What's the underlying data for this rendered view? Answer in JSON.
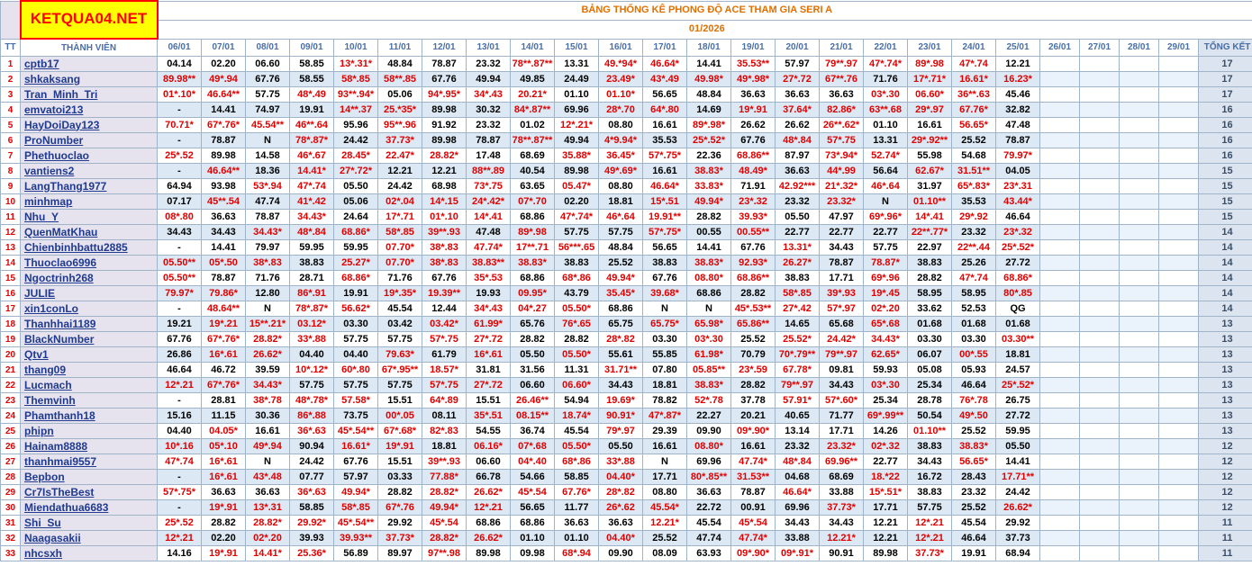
{
  "logo": "KETQUA04.NET",
  "title": "BẢNG THỐNG KÊ PHONG ĐỘ ACE THAM GIA SERI A",
  "month": "01/2026",
  "headers": {
    "tt": "TT",
    "member": "THÀNH VIÊN",
    "dates": [
      "06/01",
      "07/01",
      "08/01",
      "09/01",
      "10/01",
      "11/01",
      "12/01",
      "13/01",
      "14/01",
      "15/01",
      "16/01",
      "17/01",
      "18/01",
      "19/01",
      "20/01",
      "21/01",
      "22/01",
      "23/01",
      "24/01",
      "25/01",
      "26/01",
      "27/01",
      "28/01",
      "29/01"
    ],
    "total": "TỔNG KẾT"
  },
  "rows": [
    {
      "tt": "1",
      "name": "cptb17",
      "vals": [
        "04.14",
        "02.20",
        "06.60",
        "58.85",
        "13*.31*",
        "48.84",
        "78.87",
        "23.32",
        "78**.87**",
        "13.31",
        "49.*94*",
        "46.64*",
        "14.41",
        "35.53**",
        "57.97",
        "79**.97",
        "47*.74*",
        "89*.98",
        "47*.74",
        "12.21"
      ],
      "total": "17"
    },
    {
      "tt": "2",
      "name": "shkaksang",
      "vals": [
        "89.98**",
        "49*.94",
        "67.76",
        "58.55",
        "58*.85",
        "58**.85",
        "67.76",
        "49.94",
        "49.85",
        "24.49",
        "23.49*",
        "43*.49",
        "49.98*",
        "49*.98*",
        "27*.72",
        "67**.76",
        "71.76",
        "17*.71*",
        "16.61*",
        "16.23*"
      ],
      "total": "17"
    },
    {
      "tt": "3",
      "name": "Tran_Minh_Tri",
      "vals": [
        "01*.10*",
        "46.64**",
        "57.75",
        "48*.49",
        "93**.94*",
        "05.06",
        "94*.95*",
        "34*.43",
        "20.21*",
        "01.10",
        "01.10*",
        "56.65",
        "48.84",
        "36.63",
        "36.63",
        "36.63",
        "03*.30",
        "06.60*",
        "36**.63",
        "45.46"
      ],
      "total": "17"
    },
    {
      "tt": "4",
      "name": "emvatoi213",
      "vals": [
        "-",
        "14.41",
        "74.97",
        "19.91",
        "14**.37",
        "25.*35*",
        "89.98",
        "30.32",
        "84*.87**",
        "69.96",
        "28*.70",
        "64*.80",
        "14.69",
        "19*.91",
        "37.64*",
        "82.86*",
        "63**.68",
        "29*.97",
        "67.76*",
        "32.82"
      ],
      "total": "16"
    },
    {
      "tt": "5",
      "name": "HayDoiDay123",
      "vals": [
        "70.71*",
        "67*.76*",
        "45.54**",
        "46**.64",
        "95.96",
        "95**.96",
        "91.92",
        "23.32",
        "01.02",
        "12*.21*",
        "08.80",
        "16.61",
        "89*.98*",
        "26.62",
        "26.62",
        "26**.62*",
        "01.10",
        "16.61",
        "56.65*",
        "47.48"
      ],
      "total": "16"
    },
    {
      "tt": "6",
      "name": "ProNumber",
      "vals": [
        "-",
        "78.87",
        "N",
        "78*.87*",
        "24.42",
        "37.73*",
        "89.98",
        "78.87",
        "78**.87**",
        "49.94",
        "4*9.94*",
        "35.53",
        "25*.52*",
        "67.76",
        "48*.84",
        "57*.75",
        "13.31",
        "29*.92**",
        "25.52",
        "78.87"
      ],
      "total": "16"
    },
    {
      "tt": "7",
      "name": "Phethuoclao",
      "vals": [
        "25*.52",
        "89.98",
        "14.58",
        "46*.67",
        "28.45*",
        "22.47*",
        "28.82*",
        "17.48",
        "68.69",
        "35.88*",
        "36.45*",
        "57*.75*",
        "22.36",
        "68.86**",
        "87.97",
        "73*.94*",
        "52.74*",
        "55.98",
        "54.68",
        "79.97*"
      ],
      "total": "16"
    },
    {
      "tt": "8",
      "name": "vantiens2",
      "vals": [
        "-",
        "46.64**",
        "18.36",
        "14.41*",
        "27*.72*",
        "12.21",
        "12.21",
        "88**.89",
        "40.54",
        "89.98",
        "49*.69*",
        "16.61",
        "38.83*",
        "48.49*",
        "36.63",
        "44*.99",
        "56.64",
        "62.67*",
        "31.51**",
        "04.05"
      ],
      "total": "15"
    },
    {
      "tt": "9",
      "name": "LangThang1977",
      "vals": [
        "64.94",
        "93.98",
        "53*.94",
        "47*.74",
        "05.50",
        "24.42",
        "68.98",
        "73*.75",
        "63.65",
        "05.47*",
        "08.80",
        "46.64*",
        "33.83*",
        "71.91",
        "42.92***",
        "21*.32*",
        "46*.64",
        "31.97",
        "65*.83*",
        "23*.31"
      ],
      "total": "15"
    },
    {
      "tt": "10",
      "name": "minhmap",
      "vals": [
        "07.17",
        "45**.54",
        "47.74",
        "41*.42",
        "05.06",
        "02*.04",
        "14*.15",
        "24*.42*",
        "07*.70",
        "02.20",
        "18.81",
        "15*.51",
        "49.94*",
        "23*.32",
        "23.32",
        "23.32*",
        "N",
        "01.10**",
        "35.53",
        "43.44*"
      ],
      "total": "15"
    },
    {
      "tt": "11",
      "name": "Nhu_Y",
      "vals": [
        "08*.80",
        "36.63",
        "78.87",
        "34.43*",
        "24.64",
        "17*.71",
        "01*.10",
        "14*.41",
        "68.86",
        "47*.74*",
        "46*.64",
        "19.91**",
        "28.82",
        "39.93*",
        "05.50",
        "47.97",
        "69*.96*",
        "14*.41",
        "29*.92",
        "46.64"
      ],
      "total": "15"
    },
    {
      "tt": "12",
      "name": "QuenMatKhau",
      "vals": [
        "34.43",
        "34.43",
        "34.43*",
        "48*.84",
        "68.86*",
        "58*.85",
        "39**.93",
        "47.48",
        "89*.98",
        "57.75",
        "57.75",
        "57*.75*",
        "00.55",
        "00.55**",
        "22.77",
        "22.77",
        "22.77",
        "22**.77*",
        "23.32",
        "23*.32"
      ],
      "total": "14"
    },
    {
      "tt": "13",
      "name": "Chienbinhbattu2885",
      "vals": [
        "-",
        "14.41",
        "79.97",
        "59.95",
        "59.95",
        "07.70*",
        "38*.83",
        "47.74*",
        "17**.71",
        "56***.65",
        "48.84",
        "56.65",
        "14.41",
        "67.76",
        "13.31*",
        "34.43",
        "57.75",
        "22.97",
        "22**.44",
        "25*.52*"
      ],
      "total": "14"
    },
    {
      "tt": "14",
      "name": "Thuoclao6996",
      "vals": [
        "05.50**",
        "05*.50",
        "38*.83",
        "38.83",
        "25.27*",
        "07.70*",
        "38*.83",
        "38.83**",
        "38.83*",
        "38.83",
        "25.52",
        "38.83",
        "38.83*",
        "92.93*",
        "26.27*",
        "78.87",
        "78.87*",
        "38.83",
        "25.26",
        "27.72"
      ],
      "total": "14"
    },
    {
      "tt": "15",
      "name": "Ngoctrinh268",
      "vals": [
        "05.50**",
        "78.87",
        "71.76",
        "28.71",
        "68.86*",
        "71.76",
        "67.76",
        "35*.53",
        "68.86",
        "68*.86",
        "49.94*",
        "67.76",
        "08.80*",
        "68.86**",
        "38.83",
        "17.71",
        "69*.96",
        "28.82",
        "47*.74",
        "68.86*"
      ],
      "total": "14"
    },
    {
      "tt": "16",
      "name": "JULIE",
      "vals": [
        "79.97*",
        "79.86*",
        "12.80",
        "86*.91",
        "19.91",
        "19*.35*",
        "19.39**",
        "19.93",
        "09.95*",
        "43.79",
        "35.45*",
        "39.68*",
        "68.86",
        "28.82",
        "58*.85",
        "39*.93",
        "19*.45",
        "58.95",
        "58.95",
        "80*.85"
      ],
      "total": "14"
    },
    {
      "tt": "17",
      "name": "xin1conLo",
      "vals": [
        "-",
        "48.64**",
        "N",
        "78*.87*",
        "56.62*",
        "45.54",
        "12.44",
        "34*.43",
        "04*.27",
        "05.50*",
        "68.86",
        "N",
        "N",
        "45*.53**",
        "27*.42",
        "57*.97",
        "02*.20",
        "33.62",
        "52.53",
        "QG"
      ],
      "total": "14"
    },
    {
      "tt": "18",
      "name": "Thanhhai1189",
      "vals": [
        "19.21",
        "19*.21",
        "15**.21*",
        "03.12*",
        "03.30",
        "03.42",
        "03.42*",
        "61.99*",
        "65.76",
        "76*.65",
        "65.75",
        "65.75*",
        "65.98*",
        "65.86**",
        "14.65",
        "65.68",
        "65*.68",
        "01.68",
        "01.68",
        "01.68"
      ],
      "total": "13"
    },
    {
      "tt": "19",
      "name": "BlackNumber",
      "vals": [
        "67.76",
        "67*.76*",
        "28.82*",
        "33*.88",
        "57.75",
        "57.75",
        "57*.75",
        "27*.72",
        "28.82",
        "28.82",
        "28*.82",
        "03.30",
        "03*.30",
        "25.52",
        "25.52*",
        "24.42*",
        "34.43*",
        "03.30",
        "03.30",
        "03.30**"
      ],
      "total": "13"
    },
    {
      "tt": "20",
      "name": "Qtv1",
      "vals": [
        "26.86",
        "16*.61",
        "26.62*",
        "04.40",
        "04.40",
        "79.63*",
        "61.79",
        "16*.61",
        "05.50",
        "05.50*",
        "55.61",
        "55.85",
        "61.98*",
        "70.79",
        "70*.79**",
        "79**.97",
        "62.65*",
        "06.07",
        "00*.55",
        "18.81"
      ],
      "total": "13"
    },
    {
      "tt": "21",
      "name": "thang09",
      "vals": [
        "46.64",
        "46.72",
        "39.59",
        "10*.12*",
        "60*.80",
        "67*.95**",
        "18.57*",
        "31.81",
        "31.56",
        "11.31",
        "31.71**",
        "07.80",
        "05.85**",
        "23*.59",
        "67.78*",
        "09.81",
        "59.93",
        "05.08",
        "05.93",
        "24.57"
      ],
      "total": "13"
    },
    {
      "tt": "22",
      "name": "Lucmach",
      "vals": [
        "12*.21",
        "67*.76*",
        "34.43*",
        "57.75",
        "57.75",
        "57.75",
        "57*.75",
        "27*.72",
        "06.60",
        "06.60*",
        "34.43",
        "18.81",
        "38.83*",
        "28.82",
        "79**.97",
        "34.43",
        "03*.30",
        "25.34",
        "46.64",
        "25*.52*"
      ],
      "total": "13"
    },
    {
      "tt": "23",
      "name": "Themvinh",
      "vals": [
        "-",
        "28.81",
        "38*.78",
        "48*.78*",
        "57.58*",
        "15.51",
        "64*.89",
        "15.51",
        "26.46**",
        "54.94",
        "19.69*",
        "78.82",
        "52*.78",
        "37.78",
        "57.91*",
        "57*.60*",
        "25.34",
        "28.78",
        "76*.78",
        "26.75"
      ],
      "total": "13"
    },
    {
      "tt": "24",
      "name": "Phamthanh18",
      "vals": [
        "15.16",
        "11.15",
        "30.36",
        "86*.88",
        "73.75",
        "00*.05",
        "08.11",
        "35*.51",
        "08.15**",
        "18.74*",
        "90.91*",
        "47*.87*",
        "22.27",
        "20.21",
        "40.65",
        "71.77",
        "69*.99**",
        "50.54",
        "49*.50",
        "27.72"
      ],
      "total": "13"
    },
    {
      "tt": "25",
      "name": "phipn",
      "vals": [
        "04.40",
        "04.05*",
        "16.61",
        "36*.63",
        "45*.54**",
        "67*.68*",
        "82*.83",
        "54.55",
        "36.74",
        "45.54",
        "79*.97",
        "29.39",
        "09.90",
        "09*.90*",
        "13.14",
        "17.71",
        "14.26",
        "01.10**",
        "25.52",
        "59.95"
      ],
      "total": "13"
    },
    {
      "tt": "26",
      "name": "Hainam8888",
      "vals": [
        "10*.16",
        "05*.10",
        "49*.94",
        "90.94",
        "16.61*",
        "19*.91",
        "18.81",
        "06.16*",
        "07*.68",
        "05.50*",
        "05.50",
        "16.61",
        "08.80*",
        "16.61",
        "23.32",
        "23.32*",
        "02*.32",
        "38.83",
        "38.83*",
        "05.50"
      ],
      "total": "12"
    },
    {
      "tt": "27",
      "name": "thanhmai9557",
      "vals": [
        "47*.74",
        "16*.61",
        "N",
        "24.42",
        "67.76",
        "15.51",
        "39**.93",
        "06.60",
        "04*.40",
        "68*.86",
        "33*.88",
        "N",
        "69.96",
        "47.74*",
        "48*.84",
        "69.96**",
        "22.77",
        "34.43",
        "56.65*",
        "14.41"
      ],
      "total": "12"
    },
    {
      "tt": "28",
      "name": "Bepbon",
      "vals": [
        "-",
        "16*.61",
        "43*.48",
        "07.77",
        "57.97",
        "03.33",
        "77.88*",
        "66.78",
        "54.66",
        "58.85",
        "04.40*",
        "17.71",
        "80*.85**",
        "31.53**",
        "04.68",
        "68.69",
        "18.*22",
        "16.72",
        "28.43",
        "17.71**"
      ],
      "total": "12"
    },
    {
      "tt": "29",
      "name": "Cr7IsTheBest",
      "vals": [
        "57*.75*",
        "36.63",
        "36.63",
        "36*.63",
        "49.94*",
        "28.82",
        "28.82*",
        "26.62*",
        "45*.54",
        "67.76*",
        "28*.82",
        "08.80",
        "36.63",
        "78.87",
        "46.64*",
        "33.88",
        "15*.51*",
        "38.83",
        "23.32",
        "24.42"
      ],
      "total": "12"
    },
    {
      "tt": "30",
      "name": "Miendathua6683",
      "vals": [
        "-",
        "19*.91",
        "13*.31",
        "58.85",
        "58*.85",
        "67*.76",
        "49.94*",
        "12*.21",
        "56.65",
        "11.77",
        "26*.62",
        "45.54*",
        "22.72",
        "00.91",
        "69.96",
        "37.73*",
        "17.71",
        "57.75",
        "25.52",
        "26.62*"
      ],
      "total": "12"
    },
    {
      "tt": "31",
      "name": "Shi_Su",
      "vals": [
        "25*.52",
        "28.82",
        "28.82*",
        "29.92*",
        "45*.54**",
        "29.92",
        "45*.54",
        "68.86",
        "68.86",
        "36.63",
        "36.63",
        "12.21*",
        "45.54",
        "45*.54",
        "34.43",
        "34.43",
        "12.21",
        "12*.21",
        "45.54",
        "29.92"
      ],
      "total": "11"
    },
    {
      "tt": "32",
      "name": "Naagasakii",
      "vals": [
        "12*.21",
        "02.20",
        "02*.20",
        "39.93",
        "39.93**",
        "37.73*",
        "28.82*",
        "26.62*",
        "01.10",
        "01.10",
        "04.40*",
        "25.52",
        "47.74",
        "47.74*",
        "33.88",
        "12.21*",
        "12.21",
        "12*.21",
        "46.64",
        "37.73"
      ],
      "total": "11"
    },
    {
      "tt": "33",
      "name": "nhcsxh",
      "vals": [
        "14.16",
        "19*.91",
        "14.41*",
        "25.36*",
        "56.89",
        "89.97",
        "97**.98",
        "89.98",
        "09.98",
        "68*.94",
        "09.90",
        "08.09",
        "63.93",
        "09*.90*",
        "09*.91*",
        "90.91",
        "89.98",
        "37.73*",
        "19.91",
        "68.94"
      ],
      "total": "11"
    }
  ]
}
